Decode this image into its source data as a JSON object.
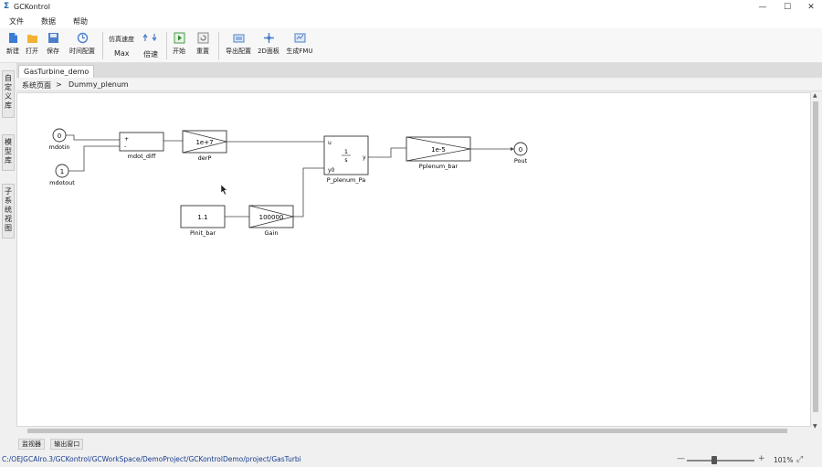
{
  "window": {
    "title": "GCKontrol",
    "min": "—",
    "max": "☐",
    "close": "✕"
  },
  "menu": [
    "文件",
    "数据",
    "帮助"
  ],
  "toolbar": {
    "new": "新建",
    "open": "打开",
    "save": "保存",
    "time_config": "时间配置",
    "speed_label": "仿真速度",
    "speed_value": "Max",
    "speed_mult": "倍速",
    "start": "开始",
    "reset": "重置",
    "export_config": "导出配置",
    "panel_2d": "2D面板",
    "gen_fmu": "生成FMU"
  },
  "side_tabs": [
    "自定义库",
    "模型库",
    "子系统视图"
  ],
  "doc_tab": "GasTurbine_demo",
  "breadcrumb": {
    "root": "系统页面",
    "sep": ">",
    "current": "Dummy_plenum"
  },
  "diagram": {
    "ports_in": [
      {
        "value": "0",
        "name": "mdotin"
      },
      {
        "value": "1",
        "name": "mdotout"
      }
    ],
    "sum_block": {
      "name": "mdot_diff",
      "plus": "+",
      "minus": "-"
    },
    "gain_derP": {
      "value": "1e+7",
      "name": "derP"
    },
    "integrator": {
      "name": "P_plenum_Pa",
      "u": "u",
      "y0": "y0",
      "y": "y",
      "num": "1",
      "den": "s"
    },
    "gain_pplenum": {
      "value": "1e-5",
      "name": "Pplenum_bar"
    },
    "port_out": {
      "value": "0",
      "name": "Pout"
    },
    "const_block": {
      "value": "1.1",
      "name": "Pinit_bar"
    },
    "gain_block": {
      "value": "100000",
      "name": "Gain"
    }
  },
  "status": {
    "bottom_tabs": [
      "监视器",
      "输出窗口"
    ],
    "path": "C:/OEJGCAIro.3/GCKontrol/GCWorkSpace/DemoProject/GCKontrolDemo/project/GasTurbi",
    "zoom_minus": "—",
    "zoom_plus": "+",
    "zoom": "101%",
    "zoom_level": 0.41
  }
}
